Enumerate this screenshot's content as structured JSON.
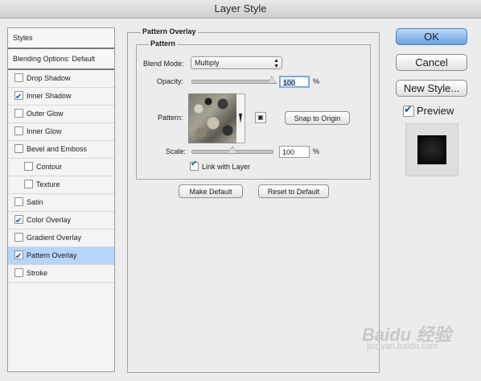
{
  "window": {
    "title": "Layer Style"
  },
  "styles_panel": {
    "header": "Styles",
    "blending_options": "Blending Options: Default",
    "items": [
      {
        "label": "Drop Shadow",
        "checked": false,
        "sub": false
      },
      {
        "label": "Inner Shadow",
        "checked": true,
        "sub": false
      },
      {
        "label": "Outer Glow",
        "checked": false,
        "sub": false
      },
      {
        "label": "Inner Glow",
        "checked": false,
        "sub": false
      },
      {
        "label": "Bevel and Emboss",
        "checked": false,
        "sub": false
      },
      {
        "label": "Contour",
        "checked": false,
        "sub": true
      },
      {
        "label": "Texture",
        "checked": false,
        "sub": true
      },
      {
        "label": "Satin",
        "checked": false,
        "sub": false
      },
      {
        "label": "Color Overlay",
        "checked": true,
        "sub": false
      },
      {
        "label": "Gradient Overlay",
        "checked": false,
        "sub": false
      },
      {
        "label": "Pattern Overlay",
        "checked": true,
        "sub": false,
        "selected": true
      },
      {
        "label": "Stroke",
        "checked": false,
        "sub": false
      }
    ]
  },
  "pattern_overlay": {
    "group_title": "Pattern Overlay",
    "inner_title": "Pattern",
    "blend_mode_label": "Blend Mode:",
    "blend_mode_value": "Multiply",
    "opacity_label": "Opacity:",
    "opacity_value": "100",
    "opacity_unit": "%",
    "pattern_label": "Pattern:",
    "snap_button": "Snap to Origin",
    "scale_label": "Scale:",
    "scale_value": "100",
    "scale_unit": "%",
    "link_label": "Link with Layer",
    "link_checked": true,
    "make_default": "Make Default",
    "reset_default": "Reset to Default"
  },
  "actions": {
    "ok": "OK",
    "cancel": "Cancel",
    "new_style": "New Style...",
    "preview_label": "Preview"
  },
  "watermark": {
    "text": "Baidu 经验",
    "url": "jingyan.baidu.com"
  }
}
